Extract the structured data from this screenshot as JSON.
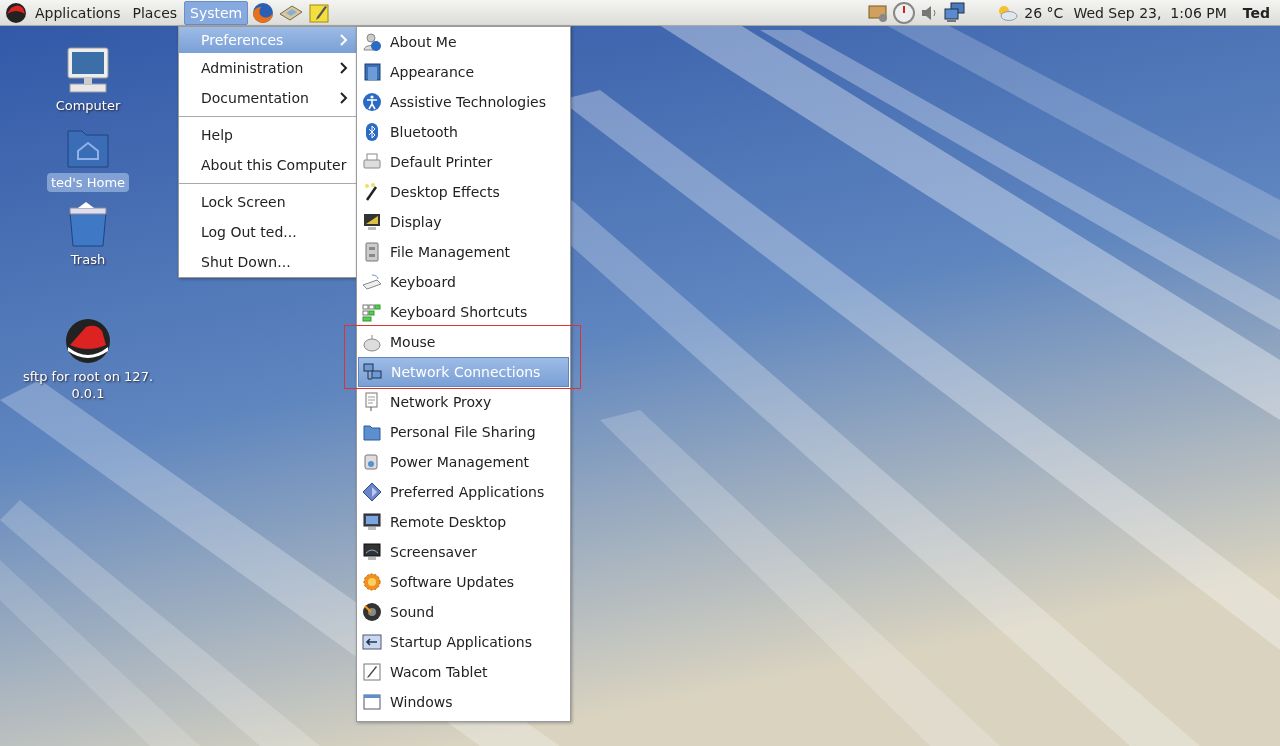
{
  "top_panel": {
    "menus": [
      {
        "label": "Applications",
        "selected": false
      },
      {
        "label": "Places",
        "selected": false
      },
      {
        "label": "System",
        "selected": true
      }
    ],
    "weather": "26 °C",
    "clock": "Wed Sep 23,  1:06 PM",
    "user": "Ted"
  },
  "desktop_icons": [
    {
      "label": "Computer",
      "selected": false
    },
    {
      "label": "ted's Home",
      "selected": true
    },
    {
      "label": "Trash",
      "selected": false
    },
    {
      "label": "sftp for root on 127.\n0.0.1",
      "selected": false
    }
  ],
  "system_menu": {
    "items": [
      {
        "kind": "submenu",
        "label": "Preferences",
        "selected": true
      },
      {
        "kind": "submenu",
        "label": "Administration",
        "selected": false
      },
      {
        "kind": "submenu",
        "label": "Documentation",
        "selected": false
      },
      {
        "kind": "separator"
      },
      {
        "kind": "item",
        "label": "Help",
        "selected": false
      },
      {
        "kind": "item",
        "label": "About this Computer",
        "selected": false
      },
      {
        "kind": "separator"
      },
      {
        "kind": "item",
        "label": "Lock Screen",
        "selected": false
      },
      {
        "kind": "item",
        "label": "Log Out ted...",
        "selected": false
      },
      {
        "kind": "item",
        "label": "Shut Down...",
        "selected": false
      }
    ]
  },
  "preferences_menu": {
    "items": [
      {
        "label": "About Me",
        "selected": false,
        "annotated": false
      },
      {
        "label": "Appearance",
        "selected": false,
        "annotated": false
      },
      {
        "label": "Assistive Technologies",
        "selected": false,
        "annotated": false
      },
      {
        "label": "Bluetooth",
        "selected": false,
        "annotated": false
      },
      {
        "label": "Default Printer",
        "selected": false,
        "annotated": false
      },
      {
        "label": "Desktop Effects",
        "selected": false,
        "annotated": false
      },
      {
        "label": "Display",
        "selected": false,
        "annotated": false
      },
      {
        "label": "File Management",
        "selected": false,
        "annotated": false
      },
      {
        "label": "Keyboard",
        "selected": false,
        "annotated": false
      },
      {
        "label": "Keyboard Shortcuts",
        "selected": false,
        "annotated": false
      },
      {
        "label": "Mouse",
        "selected": false,
        "annotated": true
      },
      {
        "label": "Network Connections",
        "selected": true,
        "annotated": true
      },
      {
        "label": "Network Proxy",
        "selected": false,
        "annotated": false
      },
      {
        "label": "Personal File Sharing",
        "selected": false,
        "annotated": false
      },
      {
        "label": "Power Management",
        "selected": false,
        "annotated": false
      },
      {
        "label": "Preferred Applications",
        "selected": false,
        "annotated": false
      },
      {
        "label": "Remote Desktop",
        "selected": false,
        "annotated": false
      },
      {
        "label": "Screensaver",
        "selected": false,
        "annotated": false
      },
      {
        "label": "Software Updates",
        "selected": false,
        "annotated": false
      },
      {
        "label": "Sound",
        "selected": false,
        "annotated": false
      },
      {
        "label": "Startup Applications",
        "selected": false,
        "annotated": false
      },
      {
        "label": "Wacom Tablet",
        "selected": false,
        "annotated": false
      },
      {
        "label": "Windows",
        "selected": false,
        "annotated": false
      }
    ]
  }
}
